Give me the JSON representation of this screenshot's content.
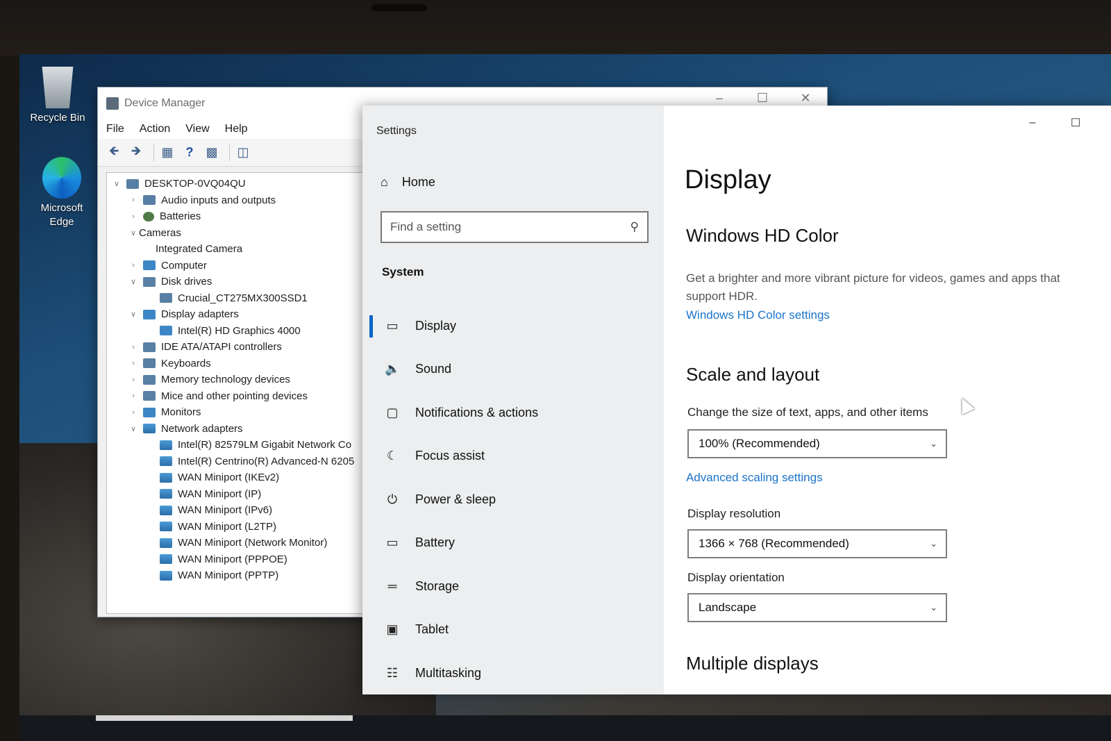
{
  "desktop": {
    "icons": [
      {
        "label": "Recycle Bin",
        "icon": "recycle-bin-icon"
      },
      {
        "label": "Microsoft Edge",
        "icon": "edge-icon"
      }
    ]
  },
  "device_manager": {
    "title": "Device Manager",
    "menu": [
      "File",
      "Action",
      "View",
      "Help"
    ],
    "toolbar_icons": [
      "back-arrow-icon",
      "forward-arrow-icon",
      "properties-icon",
      "help-icon",
      "update-driver-icon",
      "scan-hardware-icon"
    ],
    "tree": [
      {
        "label": "DESKTOP-0VQ04QU",
        "level": 0,
        "expanded": true,
        "icon": "computer-root-icon"
      },
      {
        "label": "Audio inputs and outputs",
        "level": 1,
        "expanded": false,
        "icon": "audio-icon"
      },
      {
        "label": "Batteries",
        "level": 1,
        "expanded": false,
        "icon": "battery-icon"
      },
      {
        "label": "Cameras",
        "level": 1,
        "expanded": true,
        "icon": "camera-icon"
      },
      {
        "label": "Integrated Camera",
        "level": 2,
        "icon": "camera-icon"
      },
      {
        "label": "Computer",
        "level": 1,
        "expanded": false,
        "icon": "computer-icon"
      },
      {
        "label": "Disk drives",
        "level": 1,
        "expanded": true,
        "icon": "disk-icon"
      },
      {
        "label": "Crucial_CT275MX300SSD1",
        "level": 2,
        "icon": "disk-icon"
      },
      {
        "label": "Display adapters",
        "level": 1,
        "expanded": true,
        "icon": "display-adapter-icon"
      },
      {
        "label": "Intel(R) HD Graphics 4000",
        "level": 2,
        "icon": "display-adapter-icon"
      },
      {
        "label": "IDE ATA/ATAPI controllers",
        "level": 1,
        "expanded": false,
        "icon": "controller-icon"
      },
      {
        "label": "Keyboards",
        "level": 1,
        "expanded": false,
        "icon": "keyboard-icon"
      },
      {
        "label": "Memory technology devices",
        "level": 1,
        "expanded": false,
        "icon": "memory-icon"
      },
      {
        "label": "Mice and other pointing devices",
        "level": 1,
        "expanded": false,
        "icon": "mouse-icon"
      },
      {
        "label": "Monitors",
        "level": 1,
        "expanded": false,
        "icon": "monitor-icon"
      },
      {
        "label": "Network adapters",
        "level": 1,
        "expanded": true,
        "icon": "network-icon"
      },
      {
        "label": "Intel(R) 82579LM Gigabit Network Co",
        "level": 2,
        "icon": "network-icon"
      },
      {
        "label": "Intel(R) Centrino(R) Advanced-N 6205",
        "level": 2,
        "icon": "network-icon"
      },
      {
        "label": "WAN Miniport (IKEv2)",
        "level": 2,
        "icon": "network-icon"
      },
      {
        "label": "WAN Miniport (IP)",
        "level": 2,
        "icon": "network-icon"
      },
      {
        "label": "WAN Miniport (IPv6)",
        "level": 2,
        "icon": "network-icon"
      },
      {
        "label": "WAN Miniport (L2TP)",
        "level": 2,
        "icon": "network-icon"
      },
      {
        "label": "WAN Miniport (Network Monitor)",
        "level": 2,
        "icon": "network-icon"
      },
      {
        "label": "WAN Miniport (PPPOE)",
        "level": 2,
        "icon": "network-icon"
      },
      {
        "label": "WAN Miniport (PPTP)",
        "level": 2,
        "icon": "network-icon"
      }
    ]
  },
  "settings": {
    "title": "Settings",
    "home_label": "Home",
    "search_placeholder": "Find a setting",
    "section": "System",
    "nav": [
      {
        "label": "Display",
        "icon": "monitor-icon",
        "active": true
      },
      {
        "label": "Sound",
        "icon": "speaker-icon"
      },
      {
        "label": "Notifications & actions",
        "icon": "notification-icon"
      },
      {
        "label": "Focus assist",
        "icon": "moon-icon"
      },
      {
        "label": "Power & sleep",
        "icon": "power-icon"
      },
      {
        "label": "Battery",
        "icon": "battery-icon"
      },
      {
        "label": "Storage",
        "icon": "storage-icon"
      },
      {
        "label": "Tablet",
        "icon": "tablet-icon"
      },
      {
        "label": "Multitasking",
        "icon": "multitasking-icon"
      }
    ],
    "content": {
      "page_title": "Display",
      "hd_color_heading": "Windows HD Color",
      "hd_color_desc": "Get a brighter and more vibrant picture for videos, games and apps that support HDR.",
      "hd_color_link": "Windows HD Color settings",
      "scale_heading": "Scale and layout",
      "scale_label": "Change the size of text, apps, and other items",
      "scale_value": "100% (Recommended)",
      "advanced_link": "Advanced scaling settings",
      "resolution_label": "Display resolution",
      "resolution_value": "1366 × 768 (Recommended)",
      "orientation_label": "Display orientation",
      "orientation_value": "Landscape",
      "multiple_heading": "Multiple displays"
    }
  },
  "colors": {
    "accent": "#0a64c8",
    "link": "#1a73c9"
  }
}
